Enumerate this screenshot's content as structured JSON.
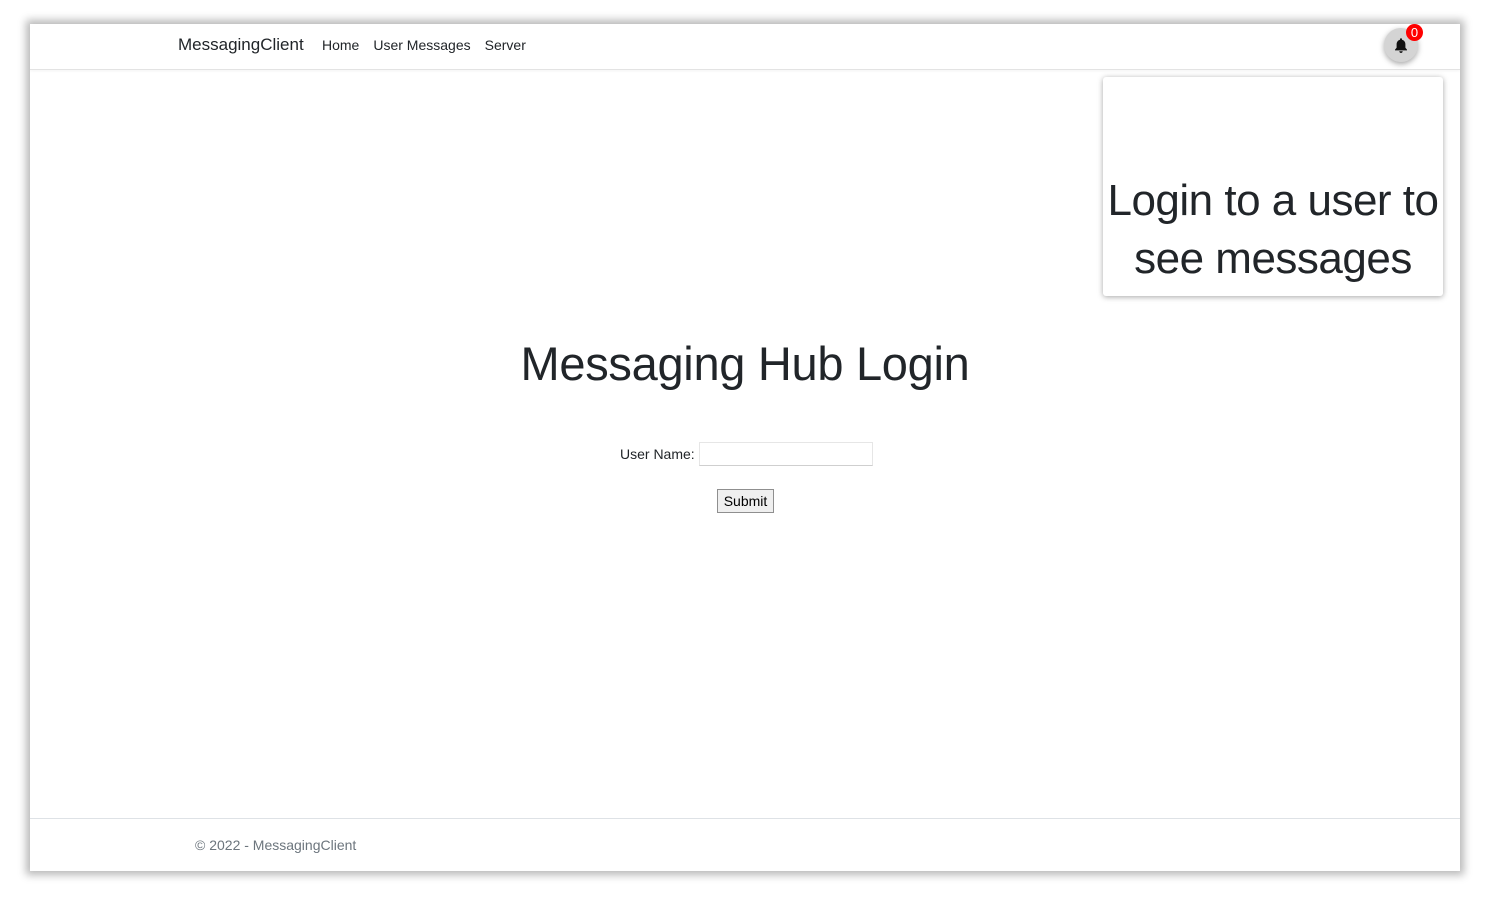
{
  "navbar": {
    "brand": "MessagingClient",
    "links": [
      "Home",
      "User Messages",
      "Server"
    ],
    "notification_count": "0"
  },
  "popup": {
    "message": "Login to a user to see messages"
  },
  "login": {
    "title": "Messaging Hub Login",
    "username_label": "User Name:",
    "username_value": "",
    "submit_label": "Submit"
  },
  "footer": {
    "text": "© 2022 - MessagingClient"
  },
  "colors": {
    "badge": "#ff0000",
    "text": "#212529",
    "muted": "#6c757d"
  },
  "icons": {
    "notification": "bell-icon"
  }
}
